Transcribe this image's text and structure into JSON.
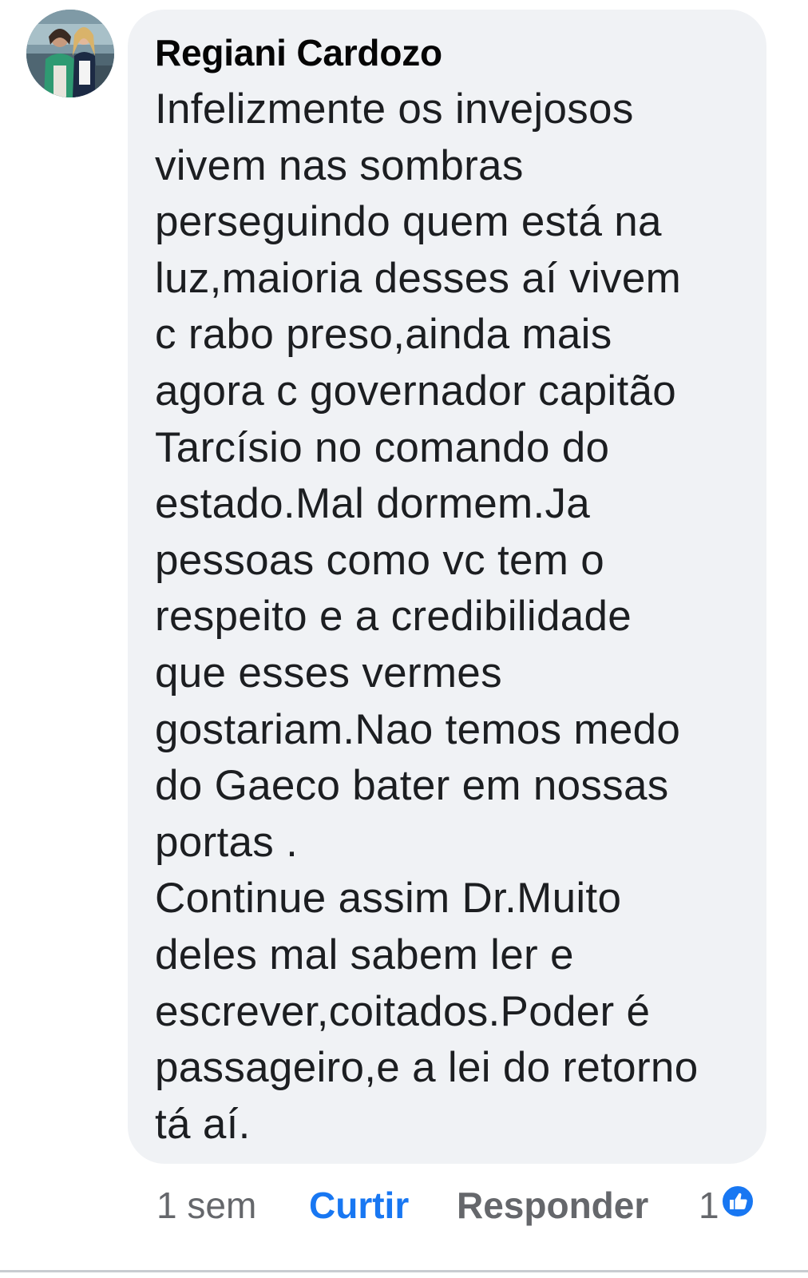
{
  "comment": {
    "author": "Regiani Cardozo",
    "text": "Infelizmente os invejosos\nvivem nas sombras\nperseguindo quem está na\nluz,maioria desses aí vivem\nc rabo preso,ainda mais\nagora c governador capitão\nTarcísio no comando do\nestado.Mal dormem.Ja\npessoas como vc tem o\nrespeito e a credibilidade\nque esses vermes\ngostariam.Nao temos medo\ndo Gaeco bater em nossas\nportas .\nContinue assim Dr.Muito\ndeles mal sabem ler e\nescrever,coitados.Poder é\npassageiro,e a lei do retorno\ntá aí."
  },
  "actions": {
    "time": "1 sem",
    "like": "Curtir",
    "reply": "Responder",
    "reaction_count": "1",
    "reaction_icon": "thumbs-up-icon"
  },
  "colors": {
    "bubble": "#f0f2f5",
    "like_active": "#1877f2",
    "meta_text": "#65676b"
  }
}
